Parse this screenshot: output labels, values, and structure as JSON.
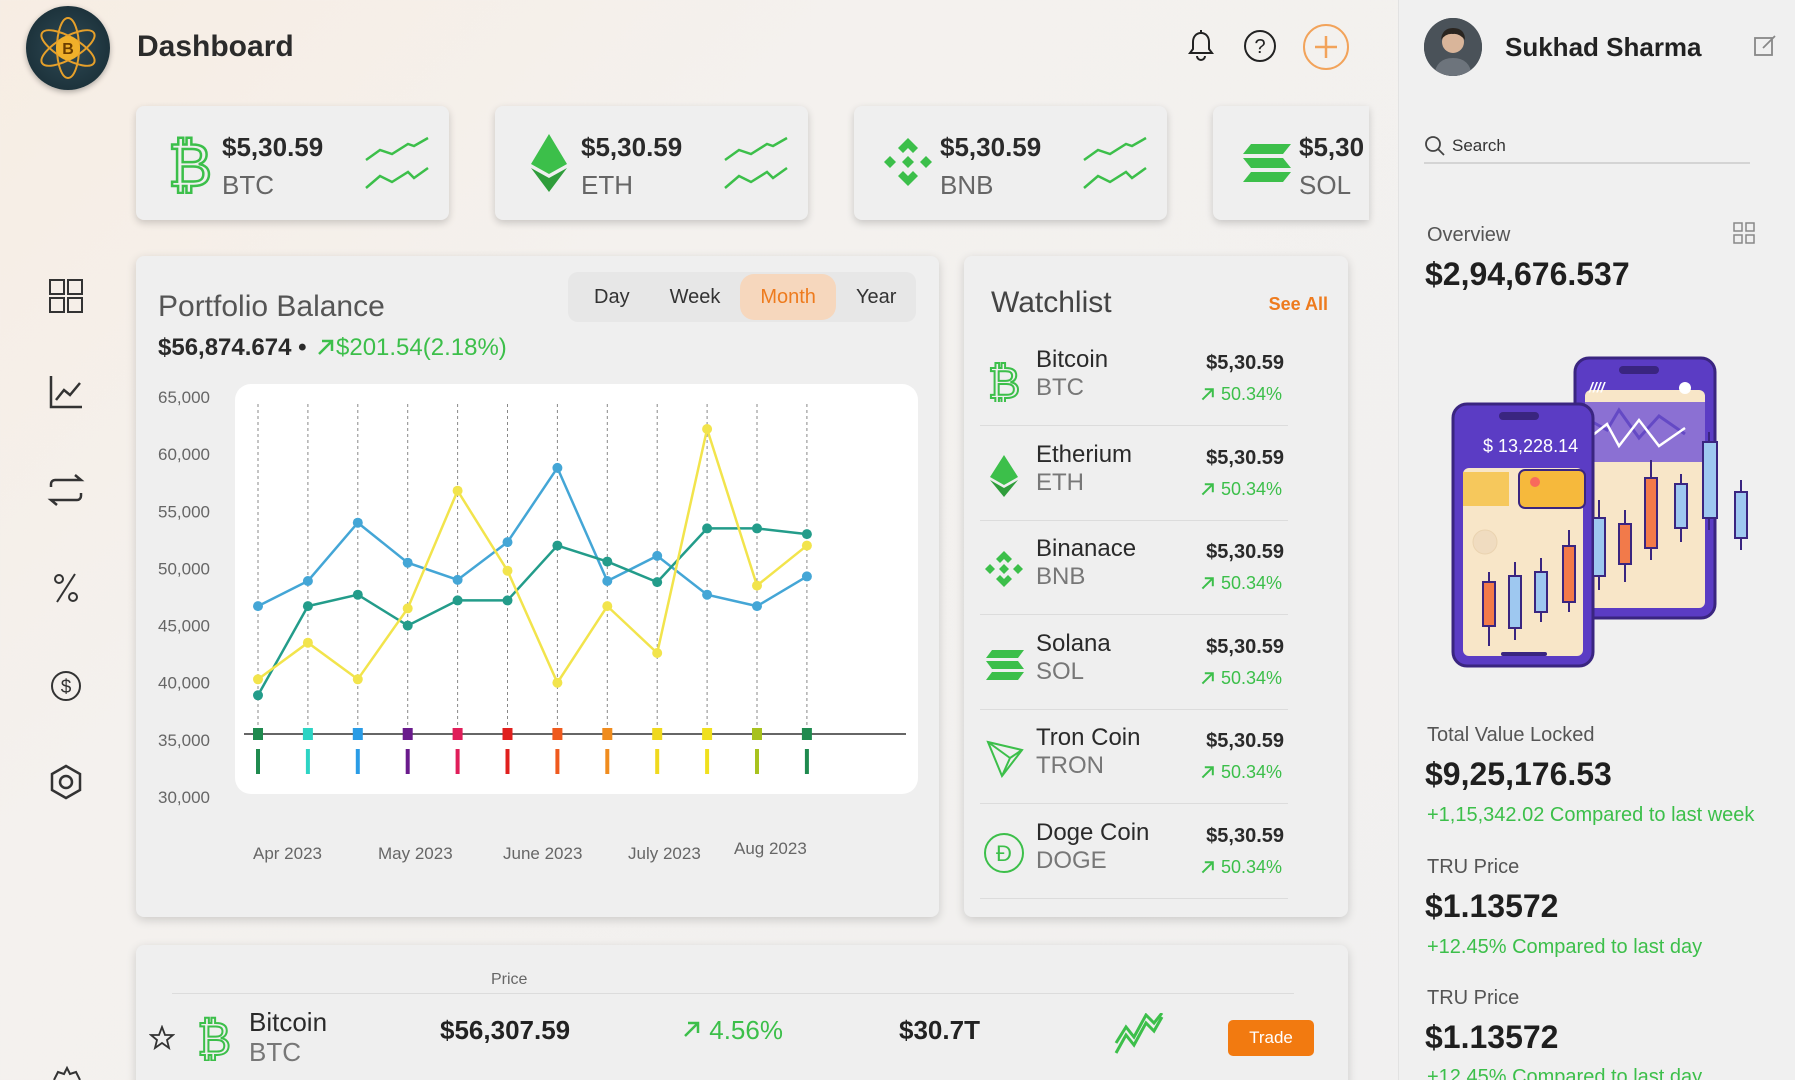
{
  "header": {
    "title": "Dashboard",
    "icons": [
      "bell-icon",
      "help-icon",
      "plus-icon"
    ]
  },
  "sidebar": {
    "items": [
      "dashboard-icon",
      "chart-icon",
      "exchange-icon",
      "percent-icon",
      "dollar-icon",
      "hexagon-icon"
    ]
  },
  "coins": [
    {
      "price": "$5,30.59",
      "symbol": "BTC",
      "icon": "bitcoin-icon"
    },
    {
      "price": "$5,30.59",
      "symbol": "ETH",
      "icon": "ethereum-icon"
    },
    {
      "price": "$5,30.59",
      "symbol": "BNB",
      "icon": "binance-icon"
    },
    {
      "price": "$5,30",
      "symbol": "SOL",
      "icon": "solana-icon"
    }
  ],
  "portfolio": {
    "title": "Portfolio Balance",
    "value": "$56,874.674",
    "separator": "•",
    "change": "$201.54(2.18%)",
    "tabs": [
      "Day",
      "Week",
      "Month",
      "Year"
    ],
    "active_tab": "Month"
  },
  "chart_data": {
    "type": "line",
    "title": "",
    "xlabel": "",
    "ylabel": "",
    "ylim": [
      30000,
      65000
    ],
    "yticks": [
      "65,000",
      "60,000",
      "55,000",
      "50,000",
      "45,000",
      "40,000",
      "35,000",
      "30,000"
    ],
    "x_labels": [
      "Apr 2023",
      "May 2023",
      "June 2023",
      "July 2023",
      "Aug 2023"
    ],
    "x_count": 12,
    "series": [
      {
        "color": "#44a6d6",
        "values": [
          46700,
          48900,
          54000,
          50500,
          49000,
          52300,
          58800,
          48900,
          51100,
          47700,
          46700,
          49300
        ]
      },
      {
        "color": "#239c8a",
        "values": [
          38900,
          46700,
          47700,
          45000,
          47200,
          47200,
          52000,
          50600,
          48800,
          53500,
          53500,
          53000
        ]
      },
      {
        "color": "#f2e44c",
        "values": [
          40300,
          43500,
          40300,
          46500,
          56800,
          49800,
          40000,
          46700,
          42600,
          62200,
          48500,
          52000
        ]
      }
    ],
    "marker_colors": [
      "#1f8a4f",
      "#2dd4c4",
      "#2a9ce6",
      "#6a1b8c",
      "#e01e5a",
      "#e0201e",
      "#ef5a1e",
      "#f08c1e",
      "#f0d91e",
      "#f0e01e",
      "#a8c21e",
      "#1f8a4f"
    ],
    "grid": true
  },
  "watchlist": {
    "title": "Watchlist",
    "see_all": "See All",
    "items": [
      {
        "name": "Bitcoin",
        "symbol": "BTC",
        "price": "$5,30.59",
        "change": "50.34%",
        "icon": "bitcoin-icon"
      },
      {
        "name": "Etherium",
        "symbol": "ETH",
        "price": "$5,30.59",
        "change": "50.34%",
        "icon": "ethereum-icon"
      },
      {
        "name": "Binanace",
        "symbol": "BNB",
        "price": "$5,30.59",
        "change": "50.34%",
        "icon": "binance-icon"
      },
      {
        "name": "Solana",
        "symbol": "SOL",
        "price": "$5,30.59",
        "change": "50.34%",
        "icon": "solana-icon"
      },
      {
        "name": "Tron Coin",
        "symbol": "TRON",
        "price": "$5,30.59",
        "change": "50.34%",
        "icon": "tron-icon"
      },
      {
        "name": "Doge Coin",
        "symbol": "DOGE",
        "price": "$5,30.59",
        "change": "50.34%",
        "icon": "doge-icon"
      }
    ]
  },
  "table": {
    "price_header": "Price",
    "rows": [
      {
        "name": "Bitcoin",
        "symbol": "BTC",
        "price": "$56,307.59",
        "change": "4.56%",
        "volume": "$30.7T",
        "action": "Trade"
      }
    ]
  },
  "profile": {
    "name": "Sukhad Sharma",
    "search_placeholder": "Search",
    "overview_label": "Overview",
    "overview_value": "$2,94,676.537",
    "illustration_price": "$ 13,228.14",
    "tvl_label": "Total Value Locked",
    "tvl_value": "$9,25,176.53",
    "tvl_change": "+1,15,342.02 Compared to last week",
    "tru1_label": "TRU Price",
    "tru1_value": "$1.13572",
    "tru1_change": "+12.45% Compared to last day",
    "tru2_label": "TRU Price",
    "tru2_value": "$1.13572",
    "tru2_change": "+12.45% Compared to last day"
  },
  "colors": {
    "accent": "#ee7b1e",
    "green": "#3cbf4a",
    "coin_green": "#3cbf4a"
  }
}
